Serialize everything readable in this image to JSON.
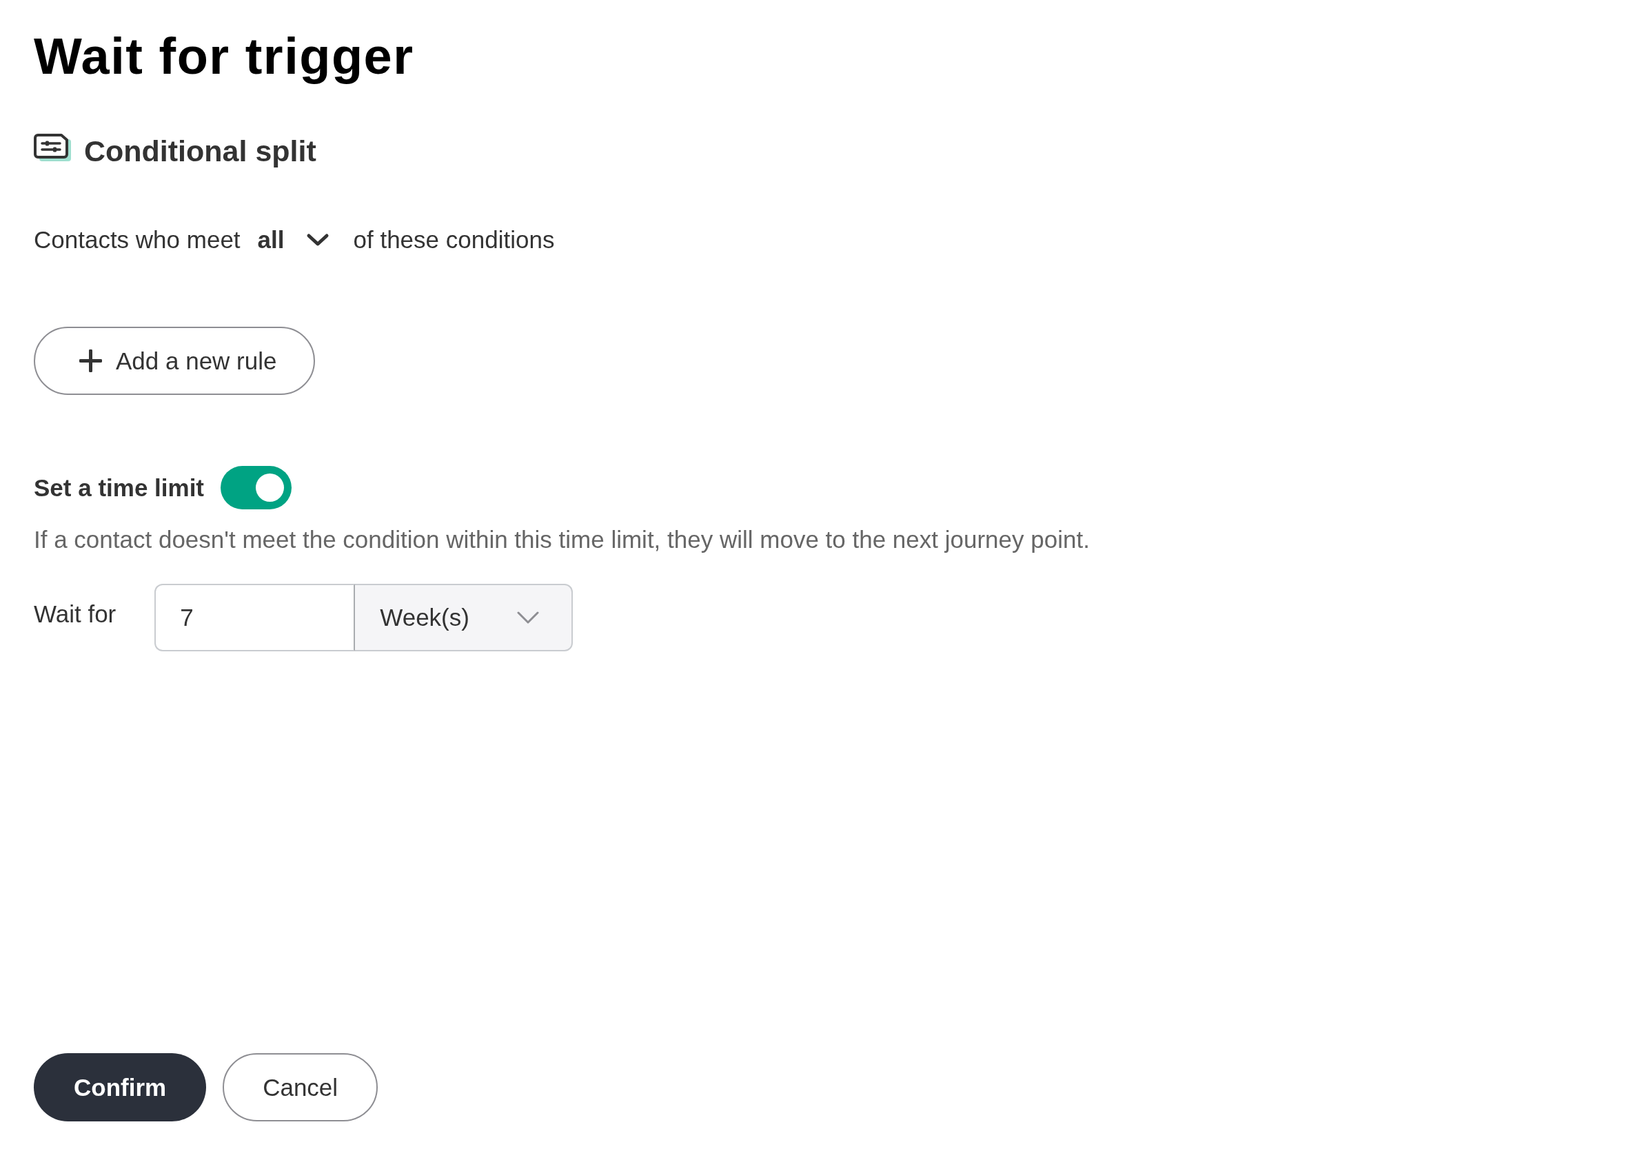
{
  "title": "Wait for trigger",
  "step": {
    "label": "Conditional split"
  },
  "match": {
    "prefix": "Contacts who meet",
    "value": "all",
    "suffix": "of these conditions"
  },
  "add_rule_button": {
    "label": "Add a new rule"
  },
  "time_limit": {
    "label": "Set a time limit",
    "on": true,
    "description": "If a contact doesn't meet the condition within this time limit, they will move to the next journey point.",
    "wait_label": "Wait for",
    "amount": "7",
    "unit": "Week(s)"
  },
  "buttons": [
    {
      "label": "Confirm",
      "kind": "primary"
    },
    {
      "label": "Cancel",
      "kind": "secondary"
    }
  ]
}
